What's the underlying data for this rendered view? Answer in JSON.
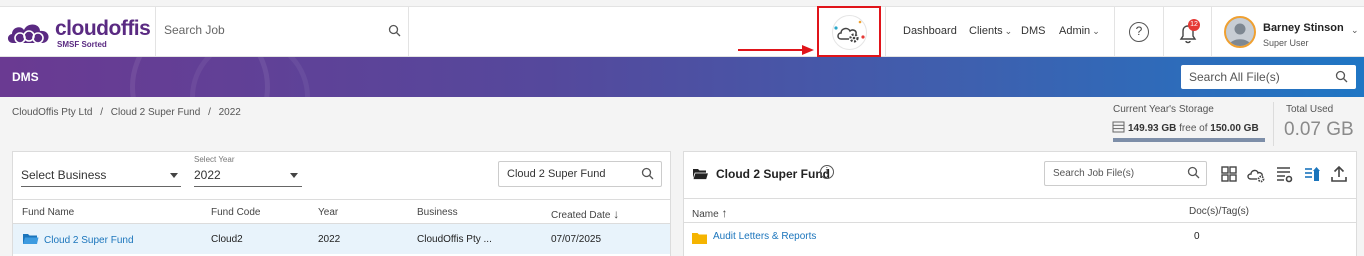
{
  "app": {
    "logo_title": "cloudoffis",
    "logo_tagline": "SMSF Sorted"
  },
  "header": {
    "search_placeholder": "Search Job",
    "nav": [
      {
        "label": "Dashboard",
        "has_dropdown": false
      },
      {
        "label": "Clients",
        "has_dropdown": true
      },
      {
        "label": "DMS",
        "has_dropdown": false
      },
      {
        "label": "Admin",
        "has_dropdown": true
      }
    ],
    "help_label": "?",
    "notification_count": "12",
    "user": {
      "name": "Barney Stinson",
      "role": "Super User"
    }
  },
  "banner": {
    "title": "DMS",
    "search_placeholder": "Search All File(s)",
    "gradient_start": "#6a3a92",
    "gradient_end": "#1f76c4"
  },
  "breadcrumb": {
    "items": [
      "CloudOffis Pty Ltd",
      "Cloud 2 Super Fund",
      "2022"
    ],
    "separator": "/"
  },
  "storage": {
    "label": "Current Year's Storage",
    "used_amount": "149.93 GB",
    "free_text": "free of",
    "total_amount": "150.00 GB",
    "fill_fraction": 0.999,
    "total_used_label": "Total Used",
    "total_used_value": "0.07 GB"
  },
  "left_panel": {
    "business_select": {
      "value": "Select Business"
    },
    "year_select": {
      "label": "Select Year",
      "value": "2022"
    },
    "fund_search_value": "Cloud 2 Super Fund",
    "columns": [
      "Fund Name",
      "Fund Code",
      "Year",
      "Business",
      "Created Date"
    ],
    "sort_indicator": "↓",
    "rows": [
      {
        "fund_name": "Cloud 2 Super Fund",
        "fund_code": "Cloud2",
        "year": "2022",
        "business": "CloudOffis Pty ...",
        "created_date": "07/07/2025"
      }
    ]
  },
  "right_panel": {
    "folder_title": "Cloud 2 Super Fund",
    "info_label": "i",
    "search_placeholder": "Search Job File(s)",
    "toolbar_icons": [
      "grid-view-icon",
      "cloud-settings-icon",
      "list-settings-icon",
      "tag-list-icon",
      "upload-icon"
    ],
    "columns": [
      "Name",
      "Doc(s)/Tag(s)"
    ],
    "sort_indicator": "↑",
    "rows": [
      {
        "name": "Audit Letters & Reports",
        "count": "0"
      }
    ]
  },
  "colors": {
    "accent": "#1b75bc",
    "highlight_box": "#e0141a",
    "brand": "#5a2a82",
    "folder": "#f5b400",
    "selected_row": "#e8f3fb"
  }
}
